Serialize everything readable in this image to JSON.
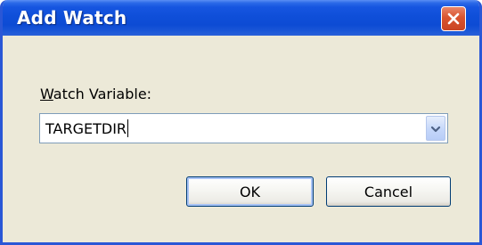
{
  "dialog": {
    "title": "Add Watch",
    "close_icon": "close-icon",
    "field_label_accel": "W",
    "field_label_rest": "atch Variable:",
    "field_value": "TARGETDIR",
    "dropdown_icon": "chevron-down-icon",
    "ok_label": "OK",
    "cancel_label": "Cancel"
  },
  "colors": {
    "titlebar": "#0d4bd4",
    "window_border": "#2a57d6",
    "window_bg": "#ece9d8",
    "close_button": "#d9542f",
    "input_border": "#7f9db9",
    "button_border": "#003c74"
  }
}
